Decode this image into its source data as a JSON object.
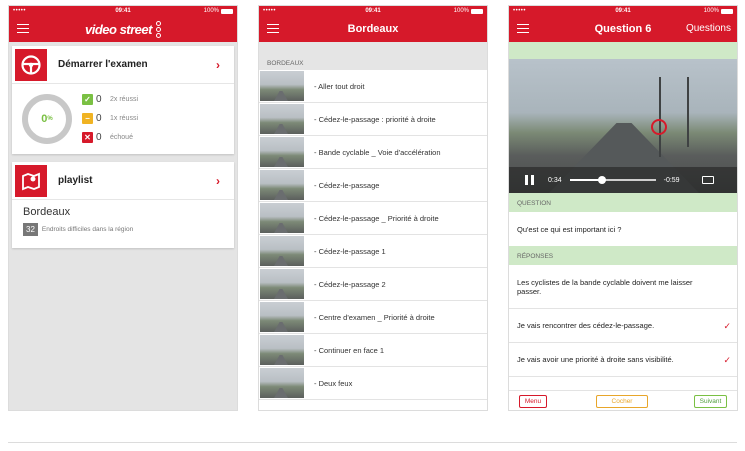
{
  "status_bar": {
    "signal": "•••••",
    "time": "09:41",
    "battery": "100%"
  },
  "colors": {
    "brand_red": "#d6192a",
    "success_green": "#7ac043",
    "warning_yellow": "#f0b323",
    "error_red": "#d6192a",
    "green_header": "#cfe9c7"
  },
  "screen1": {
    "logo_text": "video street",
    "exam_card": {
      "title": "Démarrer l'examen",
      "progress_percent": 0,
      "progress_label": "0",
      "progress_unit": "%",
      "stats": [
        {
          "icon": "check-icon",
          "count": "0",
          "label": "2x réussi"
        },
        {
          "icon": "minus-icon",
          "count": "0",
          "label": "1x réussi"
        },
        {
          "icon": "x-icon",
          "count": "0",
          "label": "échoué"
        }
      ]
    },
    "playlist_card": {
      "title": "playlist",
      "region": "Bordeaux",
      "count": "32",
      "description": "Endroits difficiles dans la région"
    }
  },
  "screen2": {
    "title": "Bordeaux",
    "section": "BORDEAUX",
    "items": [
      "- Aller tout droit",
      "- Cédez-le-passage : priorité à droite",
      "- Bande cyclable _ Voie d'accélération",
      "- Cédez-le-passage",
      "- Cédez-le-passage _ Priorité à droite",
      "- Cédez-le-passage 1",
      "- Cédez-le-passage 2",
      "- Centre d'examen _ Priorité à droite",
      "- Continuer en face 1",
      "- Deux feux"
    ]
  },
  "screen3": {
    "title": "Question 6",
    "nav_right": "Questions",
    "video": {
      "elapsed": "0:34",
      "remaining": "-0:59",
      "progress_fraction": 0.38
    },
    "question_header": "QUESTION",
    "question": "Qu'est ce qui est important ici ?",
    "answers_header": "RÉPONSES",
    "answers": [
      {
        "text": "Les cyclistes de la bande cyclable doivent me laisser passer.",
        "checked": false
      },
      {
        "text": "Je vais rencontrer des cédez-le-passage.",
        "checked": true
      },
      {
        "text": "Je vais avoir une priorité à droite sans visibilité.",
        "checked": true
      }
    ],
    "buttons": {
      "menu": "Menu",
      "check": "Cocher",
      "next": "Suivant"
    }
  }
}
